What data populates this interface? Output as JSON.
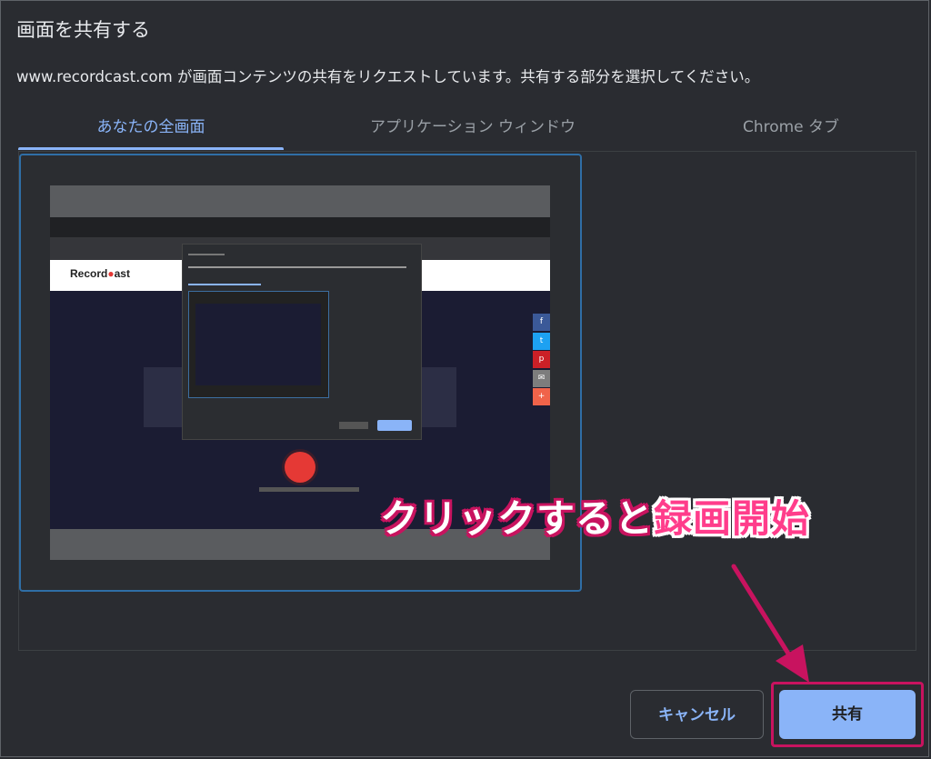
{
  "dialog": {
    "title": "画面を共有する",
    "subtitle": "www.recordcast.com が画面コンテンツの共有をリクエストしています。共有する部分を選択してください。"
  },
  "tabs": [
    {
      "label": "あなたの全画面",
      "active": true
    },
    {
      "label": "アプリケーション ウィンドウ",
      "active": false
    },
    {
      "label": "Chrome タブ",
      "active": false
    }
  ],
  "thumbnail": {
    "logo_left": "Record",
    "logo_dot": "●",
    "logo_right": "ast"
  },
  "buttons": {
    "cancel_label": "キャンセル",
    "share_label": "共有"
  },
  "annotation": {
    "text_plain": "クリックすると",
    "text_highlight": "録画開始"
  },
  "colors": {
    "accent": "#8ab4f8",
    "annotation": "#c8135f",
    "background": "#2a2c31"
  },
  "social_icons": [
    {
      "icon": "facebook-icon",
      "glyph": "f",
      "color": "#3b5998"
    },
    {
      "icon": "twitter-icon",
      "glyph": "t",
      "color": "#1da1f2"
    },
    {
      "icon": "pinterest-icon",
      "glyph": "p",
      "color": "#cb2027"
    },
    {
      "icon": "email-icon",
      "glyph": "✉",
      "color": "#7d7d7d"
    },
    {
      "icon": "share-icon",
      "glyph": "+",
      "color": "#f0634a"
    }
  ]
}
